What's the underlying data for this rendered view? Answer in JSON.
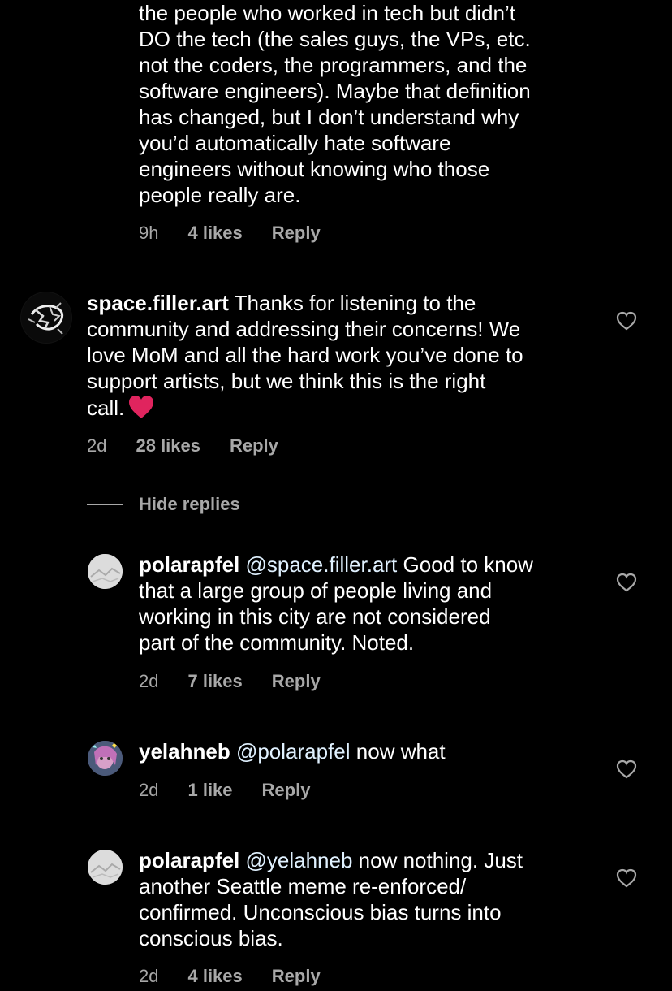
{
  "comments": [
    {
      "id": "c0",
      "username": "",
      "text": "the people who worked in tech but didn’t\nDO the tech (the sales guys, the VPs, etc.\nnot the coders, the programmers, and the\nsoftware engineers). Maybe that definition\nhas changed, but I don’t understand why\nyou’d automatically hate software\nengineers without knowing who those\npeople really are.",
      "time": "9h",
      "likes": "4 likes",
      "reply": "Reply"
    },
    {
      "id": "c1",
      "username": "space.filler.art",
      "text": " Thanks for listening to the\ncommunity and addressing their concerns! We\nlove MoM and all the hard work you’ve done to\nsupport artists, but we think this is the right\ncall.",
      "emoji": "red-heart",
      "time": "2d",
      "likes": "28 likes",
      "reply": "Reply"
    },
    {
      "id": "c2",
      "username": "polarapfel",
      "mention": "@space.filler.art",
      "text": " Good to know\nthat a large group of people living and\nworking in this city are not considered\npart of the community. Noted.",
      "time": "2d",
      "likes": "7 likes",
      "reply": "Reply"
    },
    {
      "id": "c3",
      "username": "yelahneb",
      "mention": "@polarapfel",
      "text": " now what",
      "time": "2d",
      "likes": "1 like",
      "reply": "Reply"
    },
    {
      "id": "c4",
      "username": "polarapfel",
      "mention": "@yelahneb",
      "text": " now nothing. Just\nanother Seattle meme re-enforced/\nconfirmed. Unconscious bias turns into\nconscious bias.",
      "time": "2d",
      "likes": "4 likes",
      "reply": "Reply"
    }
  ],
  "hide_replies_label": "Hide replies",
  "colors": {
    "background": "#000000",
    "text": "#ffffff",
    "meta": "#a8a8a8",
    "mention": "#e0f1ff",
    "emoji_heart": "#e0245e"
  },
  "icons": [
    "heart-outline-icon",
    "red-heart-emoji"
  ]
}
